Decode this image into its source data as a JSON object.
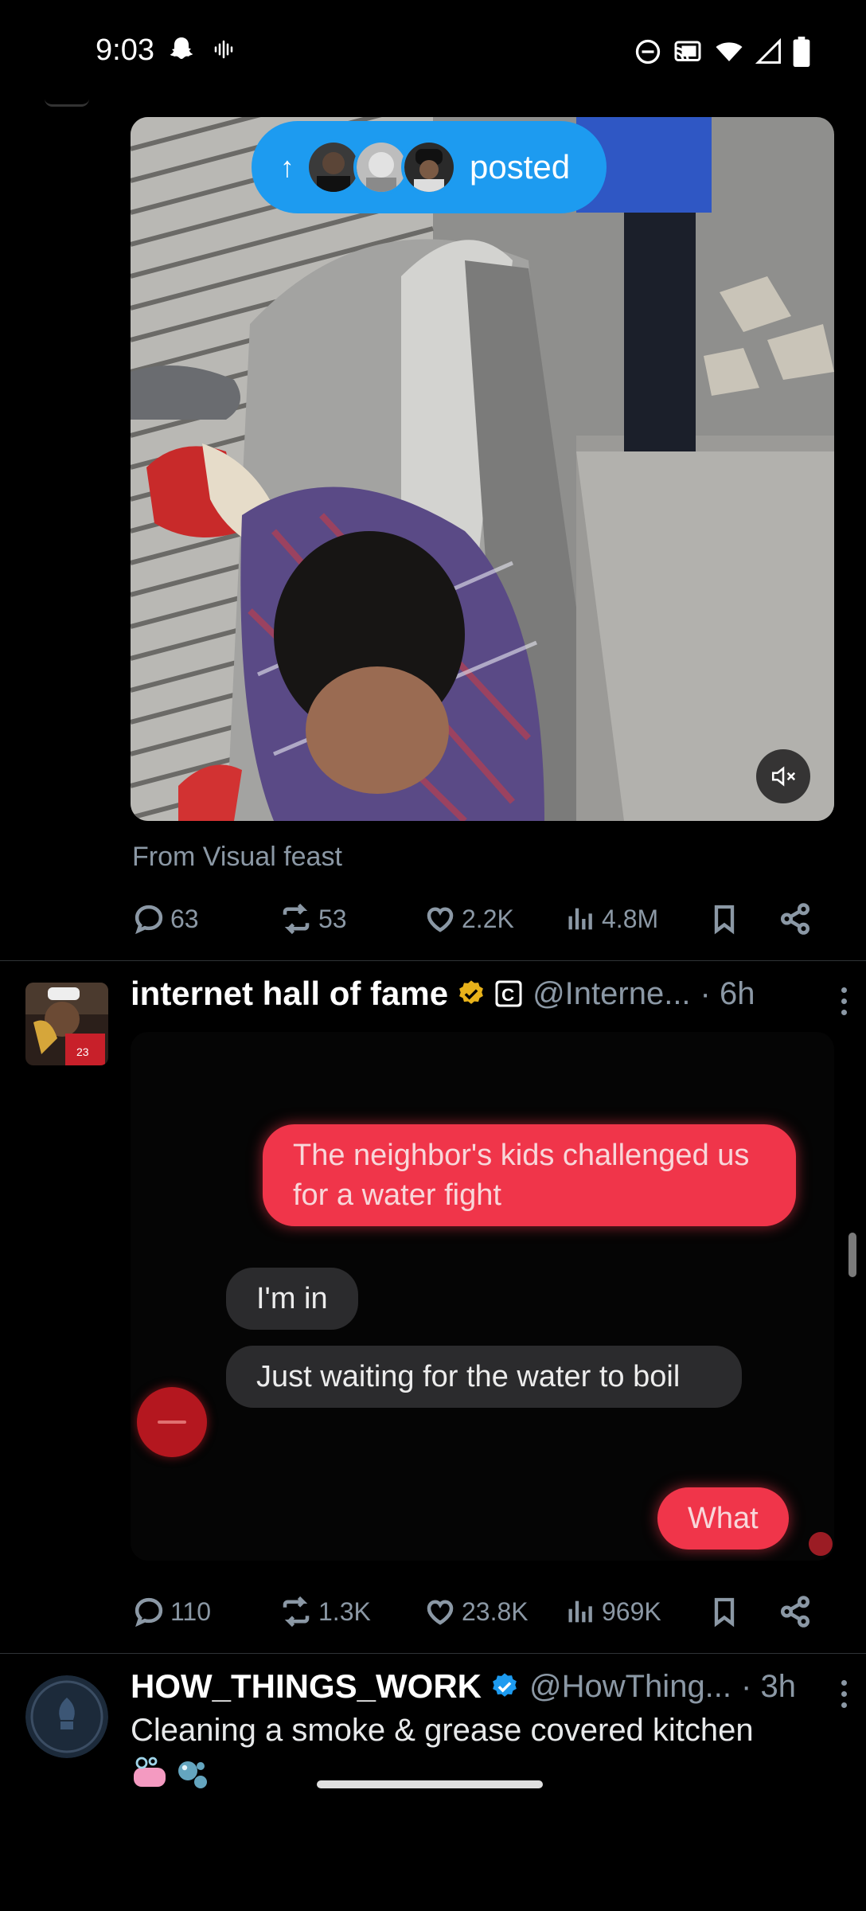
{
  "status_bar": {
    "time": "9:03",
    "left_icons": [
      "snapchat-ghost-icon",
      "voice-wave-icon"
    ],
    "right_icons": [
      "do-not-disturb-icon",
      "cast-icon",
      "wifi-icon",
      "signal-icon",
      "battery-icon"
    ]
  },
  "tweet1": {
    "posted_pill": {
      "label": "posted",
      "avatars": [
        "avatar-1",
        "avatar-2",
        "avatar-3"
      ]
    },
    "from_line": "From Visual feast",
    "stats": {
      "replies": "63",
      "reposts": "53",
      "likes": "2.2K",
      "views": "4.8M"
    }
  },
  "tweet2": {
    "name": "internet hall of fame",
    "handle": "@Interne...",
    "time": "· 6h",
    "chat": {
      "msg1": "The neighbor's kids challenged us for a water fight",
      "msg2": "I'm in",
      "msg3": "Just waiting for the water to boil",
      "msg4": "What"
    },
    "stats": {
      "replies": "110",
      "reposts": "1.3K",
      "likes": "23.8K",
      "views": "969K"
    }
  },
  "tweet3": {
    "name": "HOW_THINGS_WORK",
    "handle": "@HowThing...",
    "time": "· 3h",
    "text": "Cleaning a smoke & grease covered kitchen",
    "emoji": [
      "soap-icon",
      "bubbles-icon"
    ]
  },
  "colors": {
    "accent": "#1d9bf0",
    "gold_verified": "#e8b21a",
    "chat_red": "#f0354a"
  }
}
